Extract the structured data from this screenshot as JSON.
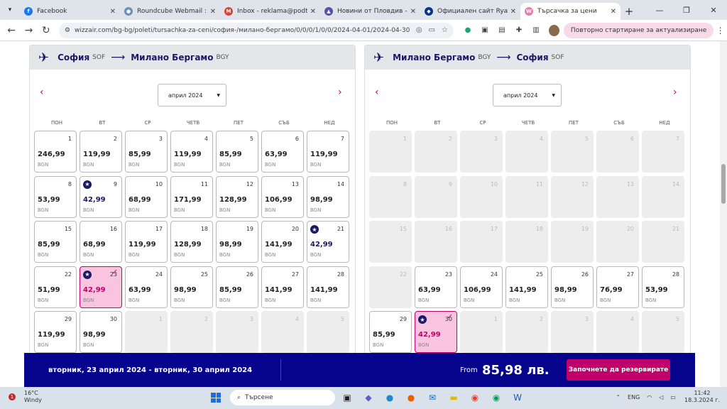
{
  "browser": {
    "tabs": [
      {
        "title": "Facebook",
        "color": "#1877f2",
        "glyph": "f",
        "active": false
      },
      {
        "title": "Roundcube Webmail :: Inbox",
        "color": "#6b8fb5",
        "glyph": "●",
        "active": false
      },
      {
        "title": "Inbox - reklama@podtepeto",
        "color": "#d44638",
        "glyph": "M",
        "active": false
      },
      {
        "title": "Новини от Пловдив - Актуално",
        "color": "#5a4fb0",
        "glyph": "▲",
        "active": false
      },
      {
        "title": "Официален сайт Ryanair | Евтини",
        "color": "#073590",
        "glyph": "◆",
        "active": false
      },
      {
        "title": "Търсачка за цени",
        "color": "#e67fb1",
        "glyph": "W",
        "active": true
      }
    ],
    "url": "wizzair.com/bg-bg/poleti/tursachka-za-ceni/софия-/милано-бергамо/0/0/0/1/0/0/2024-04-01/2024-04-30",
    "restart_label": "Повторно стартиране за актуализиране"
  },
  "outbound": {
    "from_city": "София",
    "from_code": "SOF",
    "to_city": "Милано Бергамо",
    "to_code": "BGY",
    "month": "април 2024"
  },
  "return": {
    "from_city": "Милано Бергамо",
    "from_code": "BGY",
    "to_city": "София",
    "to_code": "SOF",
    "month": "април 2024"
  },
  "weekdays": [
    "ПОН",
    "ВТ",
    "СР",
    "ЧЕТВ",
    "ПЕТ",
    "СЪБ",
    "НЕД"
  ],
  "currency": "BGN",
  "outbound_days": [
    {
      "day": "1",
      "price": "246,99"
    },
    {
      "day": "2",
      "price": "119,99"
    },
    {
      "day": "3",
      "price": "85,99"
    },
    {
      "day": "4",
      "price": "119,99"
    },
    {
      "day": "5",
      "price": "85,99"
    },
    {
      "day": "6",
      "price": "63,99"
    },
    {
      "day": "7",
      "price": "119,99"
    },
    {
      "day": "8",
      "price": "53,99"
    },
    {
      "day": "9",
      "price": "42,99",
      "star": true
    },
    {
      "day": "10",
      "price": "68,99"
    },
    {
      "day": "11",
      "price": "171,99"
    },
    {
      "day": "12",
      "price": "128,99"
    },
    {
      "day": "13",
      "price": "106,99"
    },
    {
      "day": "14",
      "price": "98,99"
    },
    {
      "day": "15",
      "price": "85,99"
    },
    {
      "day": "16",
      "price": "68,99"
    },
    {
      "day": "17",
      "price": "119,99"
    },
    {
      "day": "18",
      "price": "128,99"
    },
    {
      "day": "19",
      "price": "98,99"
    },
    {
      "day": "20",
      "price": "141,99"
    },
    {
      "day": "21",
      "price": "42,99",
      "star": true
    },
    {
      "day": "22",
      "price": "51,99"
    },
    {
      "day": "23",
      "price": "42,99",
      "star": true,
      "selected": true
    },
    {
      "day": "24",
      "price": "63,99"
    },
    {
      "day": "25",
      "price": "98,99"
    },
    {
      "day": "26",
      "price": "85,99"
    },
    {
      "day": "27",
      "price": "141,99"
    },
    {
      "day": "28",
      "price": "141,99"
    },
    {
      "day": "29",
      "price": "119,99"
    },
    {
      "day": "30",
      "price": "98,99"
    },
    {
      "day": "1",
      "empty": true
    },
    {
      "day": "2",
      "empty": true
    },
    {
      "day": "3",
      "empty": true
    },
    {
      "day": "4",
      "empty": true
    },
    {
      "day": "5",
      "empty": true
    }
  ],
  "return_days": [
    {
      "day": "1",
      "empty": true
    },
    {
      "day": "2",
      "empty": true
    },
    {
      "day": "3",
      "empty": true
    },
    {
      "day": "4",
      "empty": true
    },
    {
      "day": "5",
      "empty": true
    },
    {
      "day": "6",
      "empty": true
    },
    {
      "day": "7",
      "empty": true
    },
    {
      "day": "8",
      "empty": true
    },
    {
      "day": "9",
      "empty": true
    },
    {
      "day": "10",
      "empty": true
    },
    {
      "day": "11",
      "empty": true
    },
    {
      "day": "12",
      "empty": true
    },
    {
      "day": "13",
      "empty": true
    },
    {
      "day": "14",
      "empty": true
    },
    {
      "day": "15",
      "empty": true
    },
    {
      "day": "16",
      "empty": true
    },
    {
      "day": "17",
      "empty": true
    },
    {
      "day": "18",
      "empty": true
    },
    {
      "day": "19",
      "empty": true
    },
    {
      "day": "20",
      "empty": true
    },
    {
      "day": "21",
      "empty": true
    },
    {
      "day": "22",
      "empty": true
    },
    {
      "day": "23",
      "price": "63,99"
    },
    {
      "day": "24",
      "price": "106,99"
    },
    {
      "day": "25",
      "price": "141,99"
    },
    {
      "day": "26",
      "price": "98,99"
    },
    {
      "day": "27",
      "price": "76,99"
    },
    {
      "day": "28",
      "price": "53,99"
    },
    {
      "day": "29",
      "price": "85,99"
    },
    {
      "day": "30",
      "price": "42,99",
      "star": true,
      "selected": true
    },
    {
      "day": "1",
      "empty": true
    },
    {
      "day": "2",
      "empty": true
    },
    {
      "day": "3",
      "empty": true
    },
    {
      "day": "4",
      "empty": true
    },
    {
      "day": "5",
      "empty": true
    }
  ],
  "summary": {
    "dates": "вторник, 23 април 2024 - вторник, 30 април 2024",
    "from_label": "From",
    "total": "85,98 лв.",
    "book_label": "Започнете да резервирате"
  },
  "taskbar": {
    "temp": "16°C",
    "weather": "Windy",
    "search_placeholder": "Търсене",
    "lang": "ENG",
    "time": "11:42",
    "date": "18.3.2024 г."
  }
}
